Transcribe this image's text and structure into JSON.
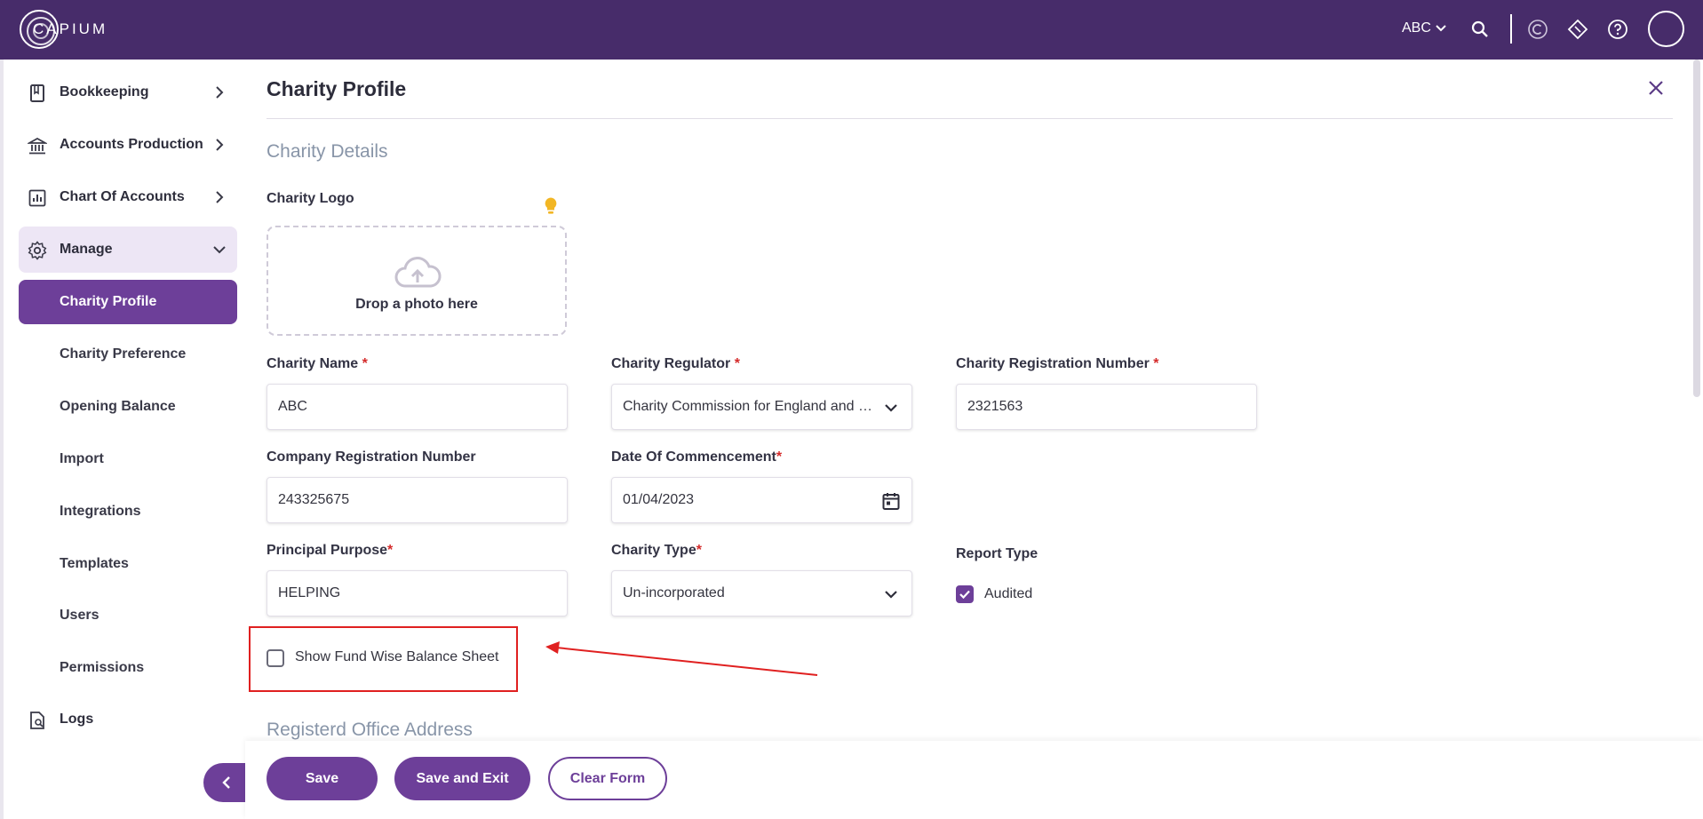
{
  "topbar": {
    "brand": "CAPIUM",
    "org": "ABC"
  },
  "sidebar": {
    "items": [
      {
        "label": "Bookkeeping"
      },
      {
        "label": "Accounts Production"
      },
      {
        "label": "Chart Of Accounts"
      },
      {
        "label": "Manage"
      }
    ],
    "sub_items": [
      {
        "label": "Charity Profile"
      },
      {
        "label": "Charity Preference"
      },
      {
        "label": "Opening Balance"
      },
      {
        "label": "Import"
      },
      {
        "label": "Integrations"
      },
      {
        "label": "Templates"
      },
      {
        "label": "Users"
      },
      {
        "label": "Permissions"
      }
    ],
    "logs": "Logs"
  },
  "main": {
    "title": "Charity Profile",
    "section_details": "Charity Details",
    "logo_label": "Charity Logo",
    "upload_text": "Drop a photo here",
    "fields": {
      "charity_name": {
        "label": "Charity Name",
        "value": "ABC"
      },
      "charity_regulator": {
        "label": "Charity Regulator",
        "value": "Charity Commission for England and Wales"
      },
      "registration_number": {
        "label": "Charity Registration Number",
        "value": "2321563"
      },
      "company_reg_number": {
        "label": "Company Registration Number",
        "value": "243325675"
      },
      "date_commencement": {
        "label": "Date Of Commencement",
        "value": "01/04/2023"
      },
      "principal_purpose": {
        "label": "Principal Purpose",
        "value": "HELPING"
      },
      "charity_type": {
        "label": "Charity Type",
        "value": "Un-incorporated"
      },
      "report_type": {
        "label": "Report Type",
        "option": "Audited",
        "checked": true
      }
    },
    "required_marker": "*",
    "fund_wise": {
      "label": "Show Fund Wise Balance Sheet",
      "checked": false
    },
    "section_address": "Registerd Office Address"
  },
  "footer": {
    "save": "Save",
    "save_exit": "Save and Exit",
    "clear": "Clear Form"
  },
  "colors": {
    "topbar": "#472c6a",
    "accent": "#6d3f99",
    "annotation": "#e02020"
  }
}
